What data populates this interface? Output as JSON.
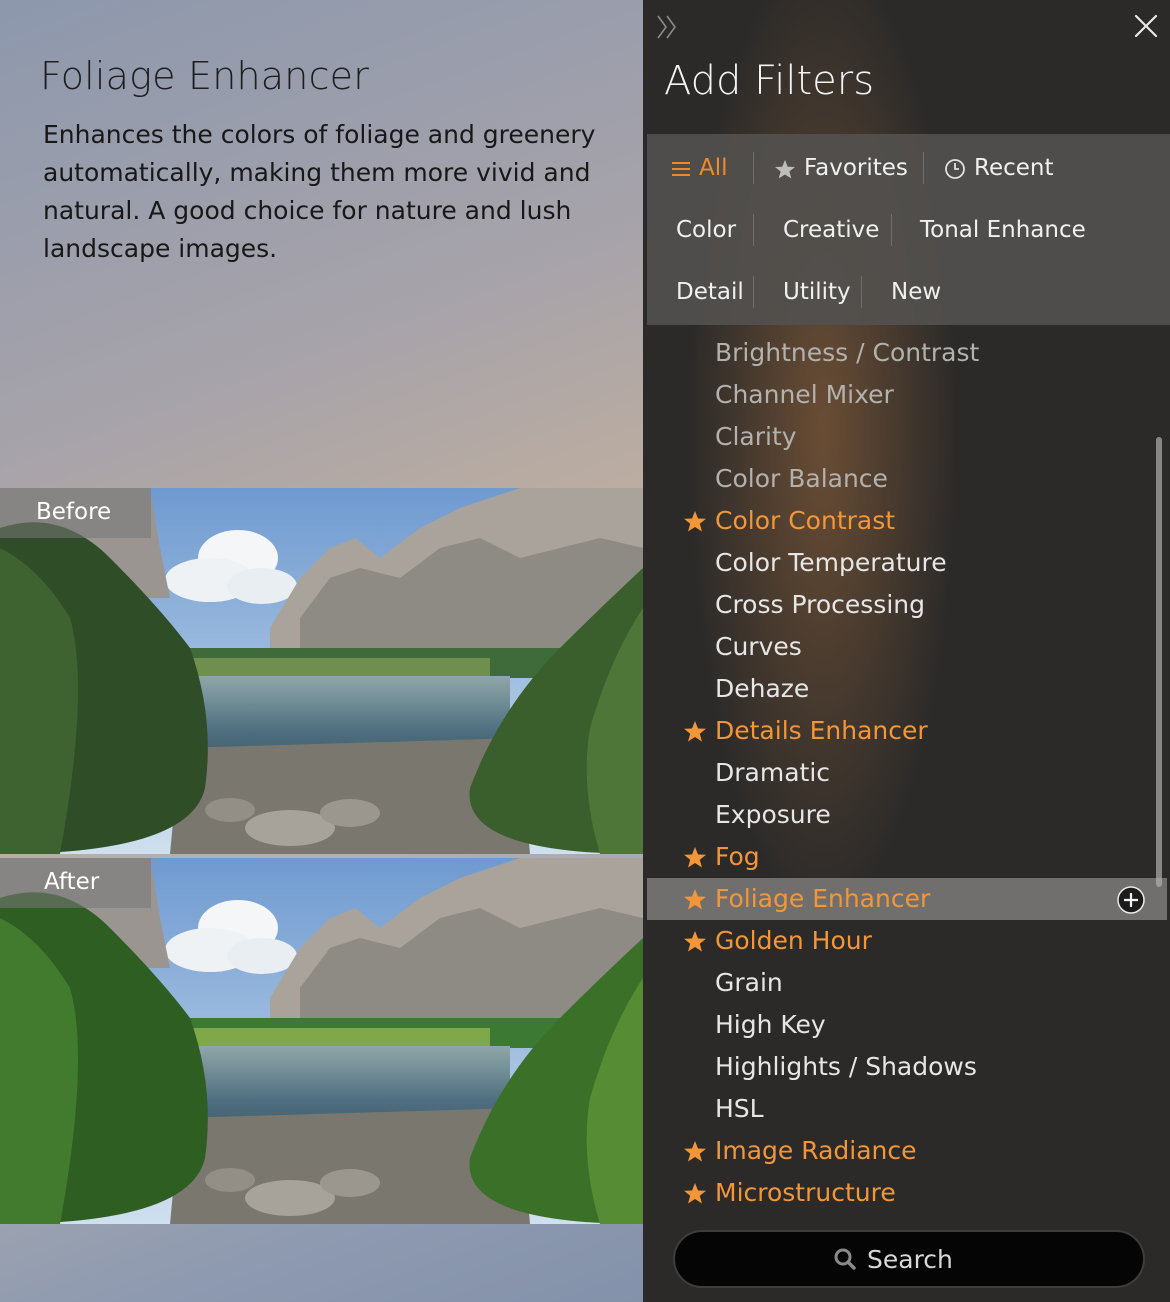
{
  "preview": {
    "title": "Foliage Enhancer",
    "description": "Enhances the colors of foliage and greenery automatically, making them more vivid and natural. A good choice for nature and lush landscape images.",
    "before_label": "Before",
    "after_label": "After"
  },
  "panel": {
    "title": "Add Filters",
    "collapse_icon": "double-chevron-right-icon",
    "close_icon": "close-icon",
    "tabs": {
      "all": "All",
      "favorites": "Favorites",
      "recent": "Recent",
      "color": "Color",
      "creative": "Creative",
      "tonal": "Tonal Enhance",
      "detail": "Detail",
      "utility": "Utility",
      "new": "New"
    },
    "active_tab": "All",
    "accent_color": "#f39638",
    "filters": [
      {
        "name": "Brightness / Contrast",
        "favorite": false
      },
      {
        "name": "Channel Mixer",
        "favorite": false
      },
      {
        "name": "Clarity",
        "favorite": false
      },
      {
        "name": "Color Balance",
        "favorite": false
      },
      {
        "name": "Color Contrast",
        "favorite": true
      },
      {
        "name": "Color Temperature",
        "favorite": false
      },
      {
        "name": "Cross Processing",
        "favorite": false
      },
      {
        "name": "Curves",
        "favorite": false
      },
      {
        "name": "Dehaze",
        "favorite": false
      },
      {
        "name": "Details Enhancer",
        "favorite": true
      },
      {
        "name": "Dramatic",
        "favorite": false
      },
      {
        "name": "Exposure",
        "favorite": false
      },
      {
        "name": "Fog",
        "favorite": true
      },
      {
        "name": "Foliage Enhancer",
        "favorite": true,
        "selected": true
      },
      {
        "name": "Golden Hour",
        "favorite": true
      },
      {
        "name": "Grain",
        "favorite": false
      },
      {
        "name": "High Key",
        "favorite": false
      },
      {
        "name": "Highlights / Shadows",
        "favorite": false
      },
      {
        "name": "HSL",
        "favorite": false
      },
      {
        "name": "Image Radiance",
        "favorite": true
      },
      {
        "name": "Microstructure",
        "favorite": true
      }
    ],
    "search_label": "Search"
  }
}
